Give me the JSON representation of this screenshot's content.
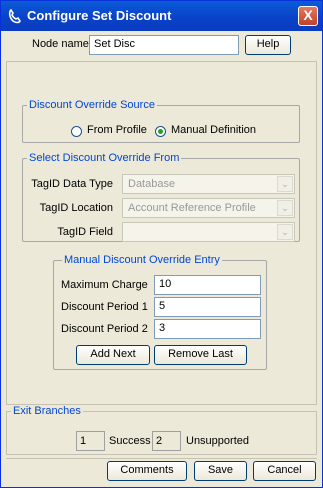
{
  "window": {
    "title": "Configure Set Discount",
    "close_glyph": "X"
  },
  "node": {
    "label": "Node name",
    "value": "Set Disc",
    "help_label": "Help"
  },
  "override_source": {
    "legend": "Discount Override Source",
    "options": [
      {
        "label": "From Profile",
        "selected": false
      },
      {
        "label": "Manual Definition",
        "selected": true
      }
    ]
  },
  "select_override": {
    "legend": "Select Discount Override From",
    "data_type": {
      "label": "TagID Data Type",
      "value": "Database"
    },
    "location": {
      "label": "TagID Location",
      "value": "Account Reference Profile"
    },
    "field": {
      "label": "TagID Field",
      "value": ""
    }
  },
  "manual_entry": {
    "legend": "Manual Discount Override Entry",
    "max_charge": {
      "label": "Maximum Charge",
      "value": "10"
    },
    "period1": {
      "label": "Discount Period 1",
      "value": "5"
    },
    "period2": {
      "label": "Discount Period 2",
      "value": "3"
    },
    "add_next": "Add Next",
    "remove_last": "Remove Last"
  },
  "exit_branches": {
    "legend": "Exit Branches",
    "items": [
      {
        "number": "1",
        "label": "Success"
      },
      {
        "number": "2",
        "label": "Unsupported"
      }
    ]
  },
  "footer": {
    "comments": "Comments",
    "save": "Save",
    "cancel": "Cancel"
  },
  "colors": {
    "title_bar": "#0a4ad0",
    "legend_text": "#0046d5",
    "window_bg": "#ece9d8"
  }
}
